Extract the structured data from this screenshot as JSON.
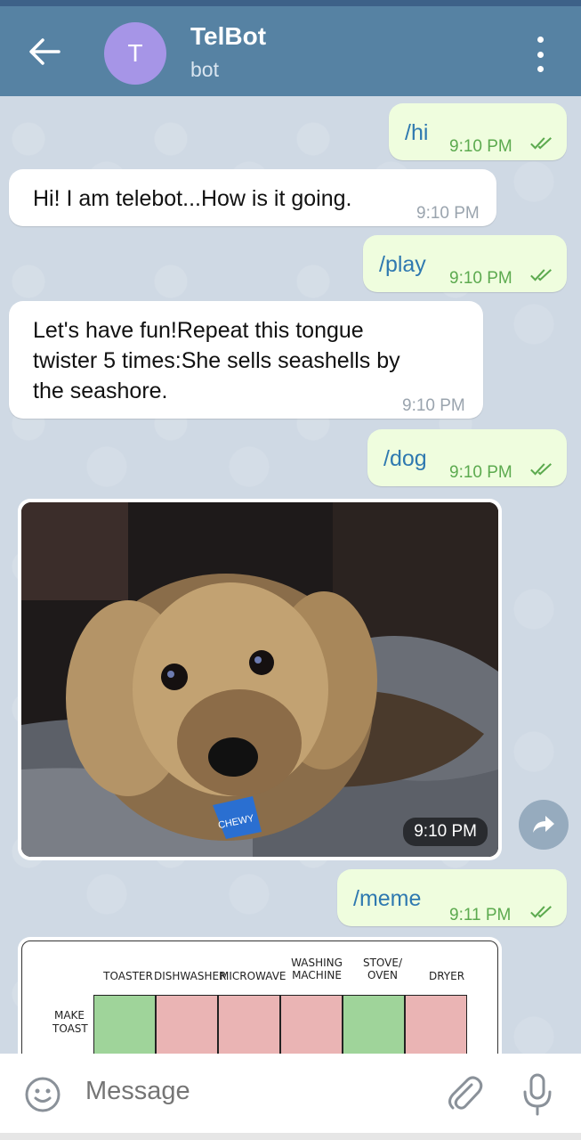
{
  "header": {
    "avatar_letter": "T",
    "title": "TelBot",
    "subtitle": "bot"
  },
  "messages": [
    {
      "direction": "out",
      "text": "/hi",
      "time": "9:10 PM",
      "status": "read"
    },
    {
      "direction": "in",
      "text": "Hi! I am telebot...How is it going.",
      "time": "9:10 PM"
    },
    {
      "direction": "out",
      "text": "/play",
      "time": "9:10 PM",
      "status": "read"
    },
    {
      "direction": "in",
      "lines": [
        "Let's have fun!Repeat this tongue",
        "twister 5 times:She sells seashells by",
        "the seashore."
      ],
      "time": "9:10 PM"
    },
    {
      "direction": "out",
      "text": "/dog",
      "time": "9:10 PM",
      "status": "read"
    },
    {
      "direction": "in",
      "type": "photo",
      "subject": "dog-photo",
      "tag_text": "CHEWY",
      "time": "9:10 PM"
    },
    {
      "direction": "out",
      "text": "/meme",
      "time": "9:11 PM",
      "status": "read"
    },
    {
      "direction": "in",
      "type": "image",
      "subject": "meme-image",
      "columns": [
        "TOASTER",
        "DISHWASHER",
        "MICROWAVE",
        "WASHING MACHINE",
        "STOVE/ OVEN",
        "DRYER"
      ],
      "row_label": "MAKE TOAST"
    }
  ],
  "input": {
    "placeholder": "Message"
  },
  "colors": {
    "header": "#5682a3",
    "outgoing_bubble": "#effdde",
    "incoming_bubble": "#ffffff",
    "avatar": "#a695e7",
    "check": "#5caa4f"
  },
  "icons": [
    "back-arrow-icon",
    "more-vert-icon",
    "forward-icon",
    "emoji-icon",
    "attach-icon",
    "mic-icon"
  ]
}
